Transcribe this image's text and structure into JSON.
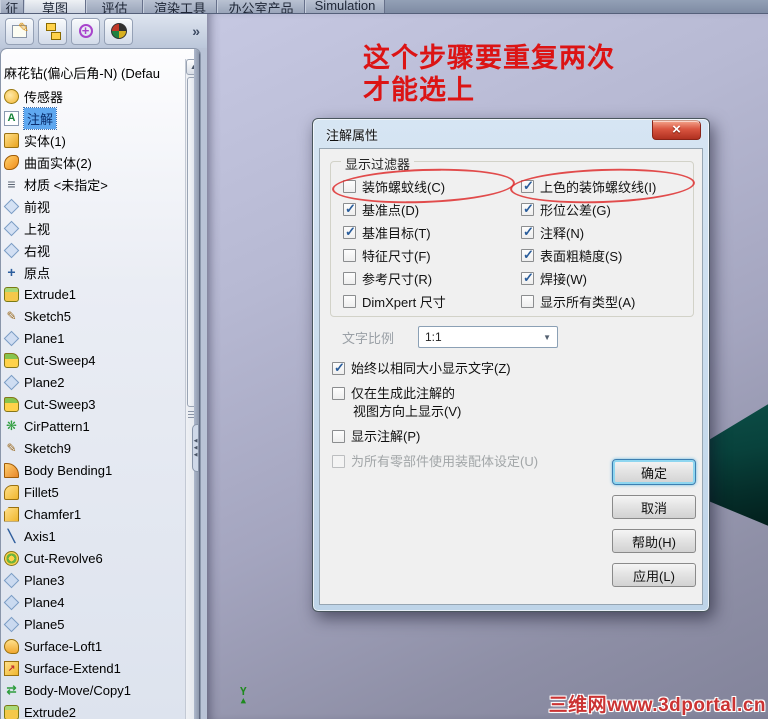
{
  "tabs": [
    {
      "label": "征"
    },
    {
      "label": "草图",
      "active": true
    },
    {
      "label": "评估"
    },
    {
      "label": "渲染工具"
    },
    {
      "label": "办公室产品"
    },
    {
      "label": "Simulation"
    }
  ],
  "icons": {
    "overflow": "»",
    "scroll_up": "▲",
    "dropdown": "▼",
    "close": "×",
    "collapse": "◀"
  },
  "tree": {
    "root": "麻花钻(偏心后角-N) (Defau",
    "items": [
      {
        "label": "传感器",
        "icon": "sensors"
      },
      {
        "label": "注解",
        "icon": "annotations",
        "selected": true
      },
      {
        "label": "实体(1)",
        "icon": "solid-bodies"
      },
      {
        "label": "曲面实体(2)",
        "icon": "surface-bodies"
      },
      {
        "label": "材质 <未指定>",
        "icon": "material"
      },
      {
        "label": "前视",
        "icon": "plane"
      },
      {
        "label": "上视",
        "icon": "plane"
      },
      {
        "label": "右视",
        "icon": "plane"
      },
      {
        "label": "原点",
        "icon": "origin"
      },
      {
        "label": "Extrude1",
        "icon": "extrude"
      },
      {
        "label": "Sketch5",
        "icon": "sketch"
      },
      {
        "label": "Plane1",
        "icon": "plane"
      },
      {
        "label": "Cut-Sweep4",
        "icon": "cut-sweep"
      },
      {
        "label": "Plane2",
        "icon": "plane"
      },
      {
        "label": "Cut-Sweep3",
        "icon": "cut-sweep"
      },
      {
        "label": "CirPattern1",
        "icon": "circular-pattern"
      },
      {
        "label": "Sketch9",
        "icon": "sketch"
      },
      {
        "label": "Body Bending1",
        "icon": "body-bending"
      },
      {
        "label": "Fillet5",
        "icon": "fillet"
      },
      {
        "label": "Chamfer1",
        "icon": "chamfer"
      },
      {
        "label": "Axis1",
        "icon": "axis"
      },
      {
        "label": "Cut-Revolve6",
        "icon": "cut-revolve"
      },
      {
        "label": "Plane3",
        "icon": "plane"
      },
      {
        "label": "Plane4",
        "icon": "plane"
      },
      {
        "label": "Plane5",
        "icon": "plane"
      },
      {
        "label": "Surface-Loft1",
        "icon": "surface-loft"
      },
      {
        "label": "Surface-Extend1",
        "icon": "surface-extend"
      },
      {
        "label": "Body-Move/Copy1",
        "icon": "body-move-copy"
      },
      {
        "label": "Extrude2",
        "icon": "extrude"
      }
    ]
  },
  "annotation": {
    "line1": "这个步骤要重复两次",
    "line2": "才能选上"
  },
  "viewport": {
    "axis_label": "Y",
    "axis_arrow": "▲"
  },
  "watermark": "三维网www.3dportal.cn",
  "dialog": {
    "title": "注解属性",
    "group_title": "显示过滤器",
    "filter_left": [
      {
        "label": "装饰螺蚊线(C)",
        "checked": false,
        "circled": true
      },
      {
        "label": "基准点(D)",
        "checked": true
      },
      {
        "label": "基准目标(T)",
        "checked": true
      },
      {
        "label": "特征尺寸(F)",
        "checked": false
      },
      {
        "label": "参考尺寸(R)",
        "checked": false
      },
      {
        "label": "DimXpert 尺寸",
        "checked": false
      }
    ],
    "filter_right": [
      {
        "label": "上色的装饰螺纹线(I)",
        "checked": true,
        "circled": true
      },
      {
        "label": "形位公差(G)",
        "checked": true
      },
      {
        "label": "注释(N)",
        "checked": true
      },
      {
        "label": "表面粗糙度(S)",
        "checked": true
      },
      {
        "label": "焊接(W)",
        "checked": true
      },
      {
        "label": "显示所有类型(A)",
        "checked": false
      }
    ],
    "text_scale": {
      "label": "文字比例",
      "value": "1:1"
    },
    "options": [
      {
        "label": "始终以相同大小显示文字(Z)",
        "checked": true
      },
      {
        "label": "仅在生成此注解的",
        "label2": "视图方向上显示(V)",
        "checked": false
      },
      {
        "label": "显示注解(P)",
        "checked": false
      },
      {
        "label": "为所有零部件使用装配体设定(U)",
        "checked": false,
        "disabled": true
      }
    ],
    "buttons": [
      {
        "label": "确定",
        "default": true
      },
      {
        "label": "取消"
      },
      {
        "label": "帮助(H)"
      },
      {
        "label": "应用(L)"
      }
    ]
  }
}
